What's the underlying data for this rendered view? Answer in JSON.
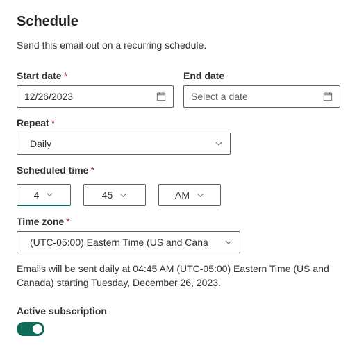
{
  "heading": "Schedule",
  "subtitle": "Send this email out on a recurring schedule.",
  "start_date": {
    "label": "Start date",
    "required": "*",
    "value": "12/26/2023"
  },
  "end_date": {
    "label": "End date",
    "placeholder": "Select a date"
  },
  "repeat": {
    "label": "Repeat",
    "required": "*",
    "value": "Daily"
  },
  "scheduled_time": {
    "label": "Scheduled time",
    "required": "*",
    "hour": "4",
    "minute": "45",
    "ampm": "AM"
  },
  "time_zone": {
    "label": "Time zone",
    "required": "*",
    "value": "(UTC-05:00) Eastern Time (US and Cana"
  },
  "summary": "Emails will be sent daily at 04:45 AM (UTC-05:00) Eastern Time (US and Canada) starting Tuesday, December 26, 2023.",
  "active_subscription": {
    "label": "Active subscription",
    "on": true
  }
}
